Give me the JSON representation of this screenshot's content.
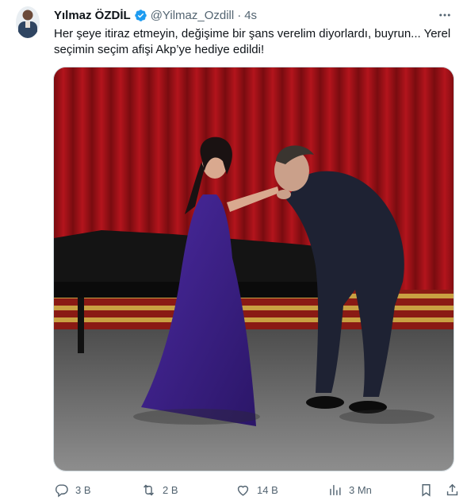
{
  "tweet": {
    "author_name": "Yılmaz ÖZDİL",
    "handle": "@Yilmaz_Ozdill",
    "separator": "·",
    "time": "4s",
    "text": "Her şeye itiraz etmeyin, değişime bir şans verelim diyorlardı, buyrun... Yerel seçimin seçim afişi Akp’ye hediye edildi!",
    "verified": true
  },
  "media": {
    "type": "photo",
    "icon": "photo-stage-scene"
  },
  "actions": {
    "replies": "3 B",
    "retweets": "2 B",
    "likes": "14 B",
    "views": "3 Mn"
  },
  "colors": {
    "verified": "#1d9bf0",
    "muted": "#536471",
    "text": "#0f1419"
  }
}
